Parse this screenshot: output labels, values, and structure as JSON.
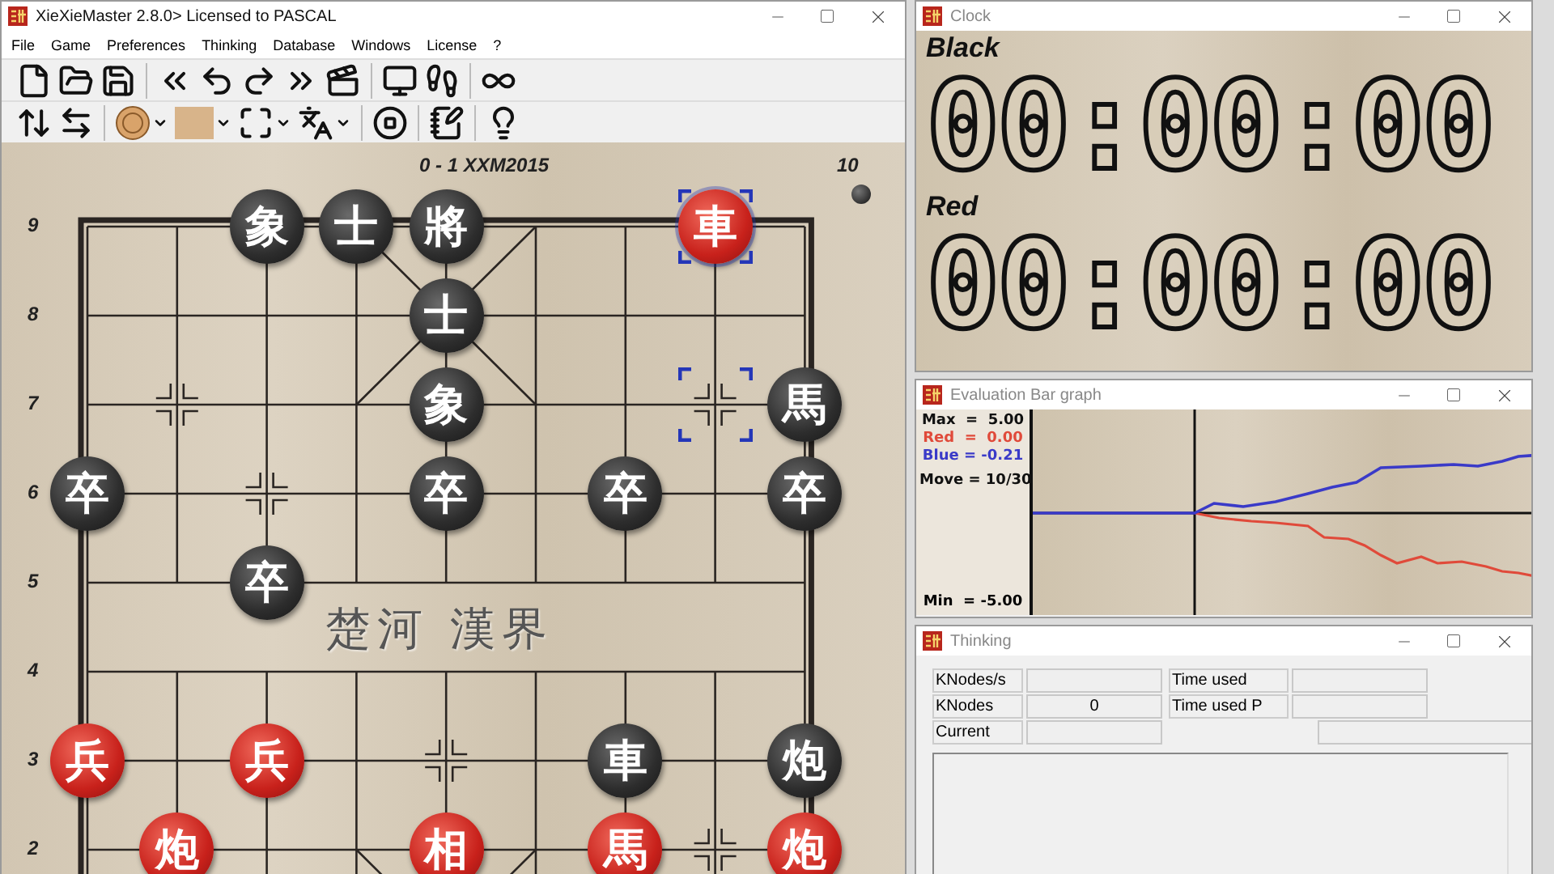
{
  "main_window": {
    "title": "XieXieMaster 2.8.0> Licensed to  PASCAL",
    "menu": [
      "File",
      "Game",
      "Preferences",
      "Thinking",
      "Database",
      "Windows",
      "License",
      "?"
    ]
  },
  "board": {
    "header": "0 - 1  XXM2015",
    "move_number": "10",
    "turn_marker": {
      "kind": "black_stone"
    },
    "river_text": "楚河 漢界",
    "ranks": [
      {
        "label": "9",
        "points": [
          {
            "kind": "empty"
          },
          {
            "kind": "empty"
          },
          {
            "kind": "black_piece",
            "glyph": "象",
            "selected": false
          },
          {
            "kind": "black_piece",
            "glyph": "士",
            "selected": false
          },
          {
            "kind": "black_piece",
            "glyph": "將",
            "selected": false
          },
          {
            "kind": "empty"
          },
          {
            "kind": "empty"
          },
          {
            "kind": "red_piece",
            "glyph": "車",
            "selected": true
          },
          {
            "kind": "empty"
          }
        ]
      },
      {
        "label": "8",
        "points": [
          {
            "kind": "empty"
          },
          {
            "kind": "empty"
          },
          {
            "kind": "empty"
          },
          {
            "kind": "empty"
          },
          {
            "kind": "black_piece",
            "glyph": "士",
            "selected": false
          },
          {
            "kind": "empty"
          },
          {
            "kind": "empty"
          },
          {
            "kind": "empty"
          },
          {
            "kind": "empty"
          }
        ]
      },
      {
        "label": "7",
        "points": [
          {
            "kind": "empty"
          },
          {
            "kind": "empty"
          },
          {
            "kind": "empty"
          },
          {
            "kind": "empty"
          },
          {
            "kind": "black_piece",
            "glyph": "象",
            "selected": false
          },
          {
            "kind": "empty"
          },
          {
            "kind": "empty"
          },
          {
            "kind": "move_target"
          },
          {
            "kind": "black_piece",
            "glyph": "馬",
            "selected": false
          }
        ]
      },
      {
        "label": "6",
        "points": [
          {
            "kind": "black_piece",
            "glyph": "卒",
            "selected": false
          },
          {
            "kind": "empty"
          },
          {
            "kind": "empty"
          },
          {
            "kind": "empty"
          },
          {
            "kind": "black_piece",
            "glyph": "卒",
            "selected": false
          },
          {
            "kind": "empty"
          },
          {
            "kind": "black_piece",
            "glyph": "卒",
            "selected": false
          },
          {
            "kind": "empty"
          },
          {
            "kind": "black_piece",
            "glyph": "卒",
            "selected": false
          }
        ]
      },
      {
        "label": "5",
        "points": [
          {
            "kind": "empty"
          },
          {
            "kind": "empty"
          },
          {
            "kind": "black_piece",
            "glyph": "卒",
            "selected": false
          },
          {
            "kind": "empty"
          },
          {
            "kind": "empty"
          },
          {
            "kind": "empty"
          },
          {
            "kind": "empty"
          },
          {
            "kind": "empty"
          },
          {
            "kind": "empty"
          }
        ]
      },
      {
        "label": "4",
        "points": [
          {
            "kind": "empty"
          },
          {
            "kind": "empty"
          },
          {
            "kind": "empty"
          },
          {
            "kind": "empty"
          },
          {
            "kind": "empty"
          },
          {
            "kind": "empty"
          },
          {
            "kind": "empty"
          },
          {
            "kind": "empty"
          },
          {
            "kind": "empty"
          }
        ]
      },
      {
        "label": "3",
        "points": [
          {
            "kind": "red_piece",
            "glyph": "兵",
            "selected": false
          },
          {
            "kind": "empty"
          },
          {
            "kind": "red_piece",
            "glyph": "兵",
            "selected": false
          },
          {
            "kind": "empty"
          },
          {
            "kind": "empty"
          },
          {
            "kind": "empty"
          },
          {
            "kind": "black_piece",
            "glyph": "車",
            "selected": false
          },
          {
            "kind": "empty"
          },
          {
            "kind": "black_piece",
            "glyph": "炮",
            "selected": false
          }
        ]
      },
      {
        "label": "2",
        "points": [
          {
            "kind": "empty"
          },
          {
            "kind": "red_piece",
            "glyph": "炮",
            "selected": false
          },
          {
            "kind": "empty"
          },
          {
            "kind": "empty"
          },
          {
            "kind": "red_piece",
            "glyph": "相",
            "selected": false
          },
          {
            "kind": "empty"
          },
          {
            "kind": "red_piece",
            "glyph": "馬",
            "selected": false
          },
          {
            "kind": "empty"
          },
          {
            "kind": "red_piece",
            "glyph": "炮",
            "selected": false
          }
        ]
      }
    ]
  },
  "clock": {
    "title": "Clock",
    "players": [
      {
        "name": "Black",
        "time": "00:00:00"
      },
      {
        "name": "Red",
        "time": "00:00:00"
      }
    ]
  },
  "evaluation": {
    "title": "Evaluation Bar graph",
    "readouts": [
      {
        "text": "Max  =  5.00",
        "color": "#111111"
      },
      {
        "text": "Red  =  0.00",
        "color": "#e04a3a"
      },
      {
        "text": "Blue = -0.21",
        "color": "#3a3ac8"
      },
      {
        "text": "Move = 10/30",
        "color": "#111111"
      }
    ],
    "min_text": "Min  = -5.00"
  },
  "thinking": {
    "title": "Thinking",
    "rows": [
      {
        "fields": [
          {
            "label": "KNodes/s"
          },
          {
            "label": "Time used"
          }
        ]
      },
      {
        "fields": [
          {
            "label": "KNodes",
            "value": "0"
          },
          {
            "label": "Time used P"
          }
        ]
      },
      {
        "fields": [
          {
            "label": "Current"
          },
          {
            "kind": "unlabeled"
          }
        ]
      }
    ]
  }
}
